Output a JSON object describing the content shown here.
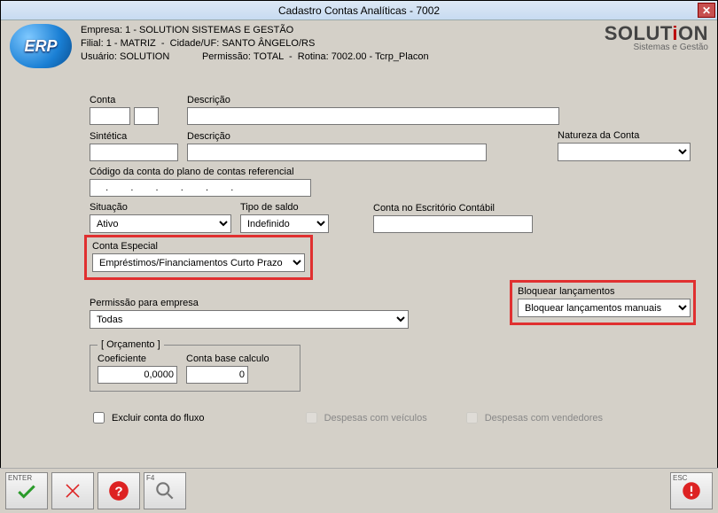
{
  "window": {
    "title": "Cadastro Contas Analíticas - 7002"
  },
  "header": {
    "empresa_label": "Empresa:",
    "empresa": "1 - SOLUTION SISTEMAS E GESTÃO",
    "filial_label": "Filial:",
    "filial": "1 - MATRIZ",
    "cidade_label": "Cidade/UF:",
    "cidade": "SANTO ÂNGELO/RS",
    "usuario_label": "Usuário:",
    "usuario": "SOLUTION",
    "permissao_label": "Permissão:",
    "permissao": "TOTAL",
    "rotina_label": "Rotina:",
    "rotina": "7002.00 - Tcrp_Placon",
    "logo_erp": "ERP",
    "logo_solution_main": "SOLUTiON",
    "logo_solution_sub": "Sistemas e Gestão"
  },
  "form": {
    "conta_label": "Conta",
    "conta_value": "",
    "descricao_label": "Descrição",
    "descricao_value": "",
    "sintetica_label": "Sintética",
    "sintetica_value": "",
    "descricao2_label": "Descrição",
    "descricao2_value": "",
    "natureza_label": "Natureza da Conta",
    "natureza_value": "",
    "codigoref_label": "Código da conta do plano de contas referencial",
    "codigoref_value": "  .   .   .   .   .   .   ",
    "situacao_label": "Situação",
    "situacao_value": "Ativo",
    "tiposaldo_label": "Tipo de saldo",
    "tiposaldo_value": "Indefinido",
    "contaescritorio_label": "Conta no Escritório Contábil",
    "contaescritorio_value": "",
    "contaespecial_label": "Conta Especial",
    "contaespecial_value": "Empréstimos/Financiamentos Curto Prazo",
    "permissao_label": "Permissão para empresa",
    "permissao_value": "Todas",
    "bloquear_label": "Bloquear lançamentos",
    "bloquear_value": "Bloquear lançamentos manuais",
    "orcamento_legend": "[ Orçamento ]",
    "coeficiente_label": "Coeficiente",
    "coeficiente_value": "0,0000",
    "contabase_label": "Conta base calculo",
    "contabase_value": "0",
    "excluir_label": "Excluir conta do fluxo",
    "despesas_veiculos_label": "Despesas com veículos",
    "despesas_vendedores_label": "Despesas com vendedores"
  },
  "footer": {
    "enter_key": "ENTER",
    "f4_key": "F4",
    "esc_key": "ESC"
  }
}
